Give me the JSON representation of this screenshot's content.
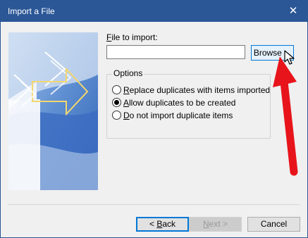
{
  "window": {
    "title": "Import a File",
    "close_glyph": "✕"
  },
  "file": {
    "label_prefix": "",
    "label_hotkey": "F",
    "label_rest": "ile to import:",
    "value": ""
  },
  "browse": {
    "label": "Browse ..."
  },
  "options": {
    "legend": "Options",
    "items": [
      {
        "hotkey": "R",
        "rest": "eplace duplicates with items imported",
        "selected": false
      },
      {
        "hotkey": "A",
        "rest": "llow duplicates to be created",
        "selected": true
      },
      {
        "hotkey": "D",
        "rest": "o not import duplicate items",
        "selected": false
      }
    ]
  },
  "buttons": {
    "back_prefix": "< ",
    "back_hotkey": "B",
    "back_rest": "ack",
    "next_hotkey": "N",
    "next_rest": "ext >",
    "cancel": "Cancel"
  },
  "colors": {
    "titlebar": "#2b5797",
    "accent": "#0078d7",
    "annotation_arrow": "#e8141b"
  }
}
